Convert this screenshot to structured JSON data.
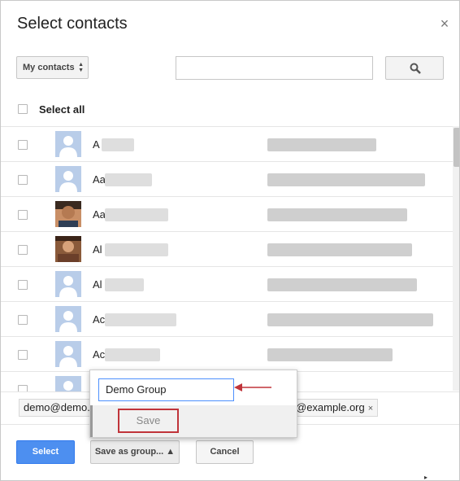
{
  "dialog": {
    "title": "Select contacts",
    "close_label": "×"
  },
  "toolbar": {
    "group_select_label": "My contacts",
    "search_placeholder": "",
    "search_icon": "search-icon"
  },
  "list": {
    "select_all_label": "Select all",
    "rows": [
      {
        "name_initial": "A",
        "avatar": "default-avatar-icon"
      },
      {
        "name_initial": "Aa",
        "avatar": "default-avatar-icon"
      },
      {
        "name_initial": "Aa",
        "avatar": "photo-avatar"
      },
      {
        "name_initial": "Al",
        "avatar": "photo-avatar"
      },
      {
        "name_initial": "Al",
        "avatar": "default-avatar-icon"
      },
      {
        "name_initial": "Ac",
        "avatar": "default-avatar-icon"
      },
      {
        "name_initial": "Ac",
        "avatar": "default-avatar-icon"
      }
    ]
  },
  "chips": [
    {
      "label": "demo@demo."
    },
    {
      "label": "@example.org",
      "remove": "×"
    }
  ],
  "popup": {
    "group_name_value": "Demo Group",
    "save_label": "Save"
  },
  "footer": {
    "select_label": "Select",
    "save_as_group_label": "Save as group... ▲",
    "cancel_label": "Cancel"
  },
  "colors": {
    "primary_button": "#4d8ff0",
    "highlight_border": "#c0343a",
    "arrow": "#c0343a",
    "input_focus": "#4d90fe"
  }
}
